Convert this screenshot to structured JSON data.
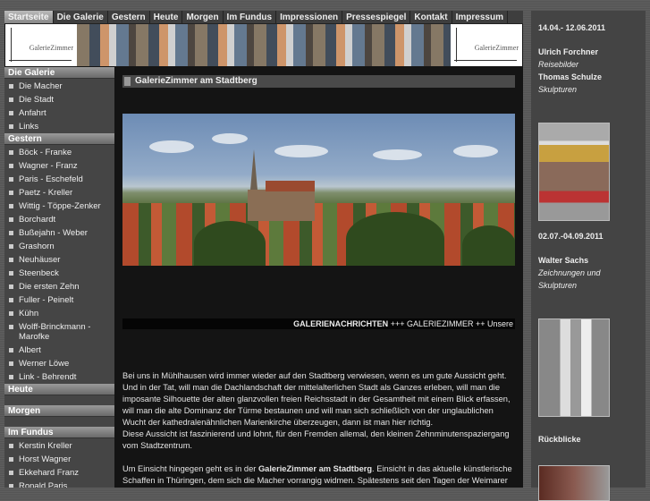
{
  "nav": [
    "Startseite",
    "Die Galerie",
    "Gestern",
    "Heute",
    "Morgen",
    "Im Fundus",
    "Impressionen",
    "Pressespiegel",
    "Kontakt",
    "Impressum"
  ],
  "banner": {
    "logo_text": "GalerieZimmer"
  },
  "sidebar": {
    "die_galerie": {
      "title": "Die Galerie",
      "items": [
        "Die Macher",
        "Die Stadt",
        "Anfahrt",
        "Links"
      ]
    },
    "gestern": {
      "title": "Gestern",
      "items": [
        "Böck - Franke",
        "Wagner - Franz",
        "Paris - Eschefeld",
        "Paetz - Kreller",
        "Wittig - Töppe-Zenker",
        "Borchardt",
        "Bußejahn - Weber",
        "Grashorn",
        "Neuhäuser",
        "Steenbeck",
        "Die ersten Zehn",
        "Fuller - Peinelt",
        "Kühn",
        "Wolff-Brinckmann - Marofke",
        "Albert",
        "Werner Löwe",
        "Link - Behrendt"
      ]
    },
    "heute": {
      "title": "Heute"
    },
    "morgen": {
      "title": "Morgen"
    },
    "im_fundus": {
      "title": "Im Fundus",
      "items": [
        "Kerstin Kreller",
        "Horst Wagner",
        "Ekkehard Franz",
        "Ronald Paris"
      ]
    }
  },
  "content": {
    "title": "GalerieZimmer am Stadtberg",
    "ticker_bold": "GALERIENACHRICHTEN",
    "ticker_rest": " +++ GALERIEZIMMER ++ Unsere",
    "p1": "Bei uns in Mühlhausen wird immer wieder auf den Stadtberg verwiesen, wenn es um gute Aussicht geht. Und in der Tat, will man die Dachlandschaft der mittelalterlichen Stadt als Ganzes erleben, will man die imposante Silhouette der alten glanzvollen freien Reichsstadt in der Gesamtheit mit einem Blick erfassen, will man die alte Dominanz der Türme bestaunen und will man sich schließlich von der unglaublichen Wucht der kathedralenähnlichen Marienkirche überzeugen, dann ist man hier richtig.",
    "p1b": "Diese Aussicht ist faszinierend und lohnt, für den Fremden allemal, den kleinen Zehnminutenspaziergang vom Stadtzentrum.",
    "p2a": "Um Einsicht hingegen geht es in der ",
    "p2b": "GalerieZimmer am Stadtberg",
    "p2c": ". Einsicht in das aktuelle künstlerische Schaffen in Thüringen, dem sich die Macher vorrangig widmen. Spätestens seit den Tagen der Weimarer Malerschule gibt es bemerkenswerte künstlerische Vorgänge im Herzen Deutschlands und viel lässt sich"
  },
  "right": {
    "date1": "14.04.- 12.06.2011",
    "artist1": "Ulrich Forchner",
    "work1": "Reisebilder",
    "artist2": "Thomas Schulze",
    "work2": "Skulpturen",
    "date2": "02.07.-04.09.2011",
    "artist3": "Walter Sachs",
    "work3": "Zeichnungen und Skulpturen",
    "rueckblicke": "Rückblicke"
  }
}
